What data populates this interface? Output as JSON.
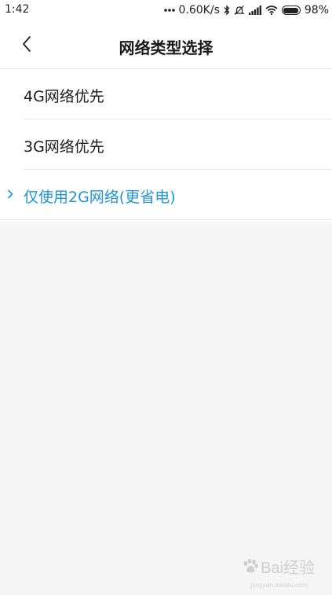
{
  "status_bar": {
    "time": "1:42",
    "net_speed": "0.60K/s",
    "battery_percent": "98%",
    "battery_level": 0.98,
    "icons": [
      "dots-icon",
      "bluetooth-icon",
      "alarm-off-icon",
      "signal-icon",
      "wifi-icon",
      "battery-icon"
    ]
  },
  "header": {
    "title": "网络类型选择",
    "back_icon": "chevron-left-icon"
  },
  "options": [
    {
      "label": "4G网络优先",
      "selected": false
    },
    {
      "label": "3G网络优先",
      "selected": false
    },
    {
      "label": "仅使用2G网络(更省电)",
      "selected": true
    }
  ],
  "colors": {
    "accent": "#1f94d6",
    "background": "#f5f5f5",
    "surface": "#ffffff",
    "text": "#1a1a1a"
  },
  "watermark": {
    "text": "Bai经验",
    "sub": "jingyan.baidu.com"
  }
}
